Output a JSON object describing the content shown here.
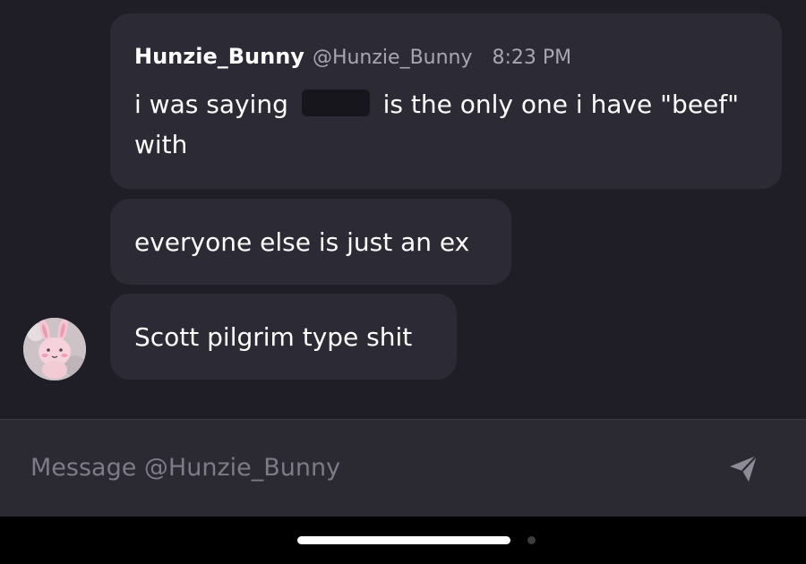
{
  "message_group": {
    "author": "Hunzie_Bunny",
    "handle": "@Hunzie_Bunny",
    "time": "8:23 PM",
    "avatar_icon": "pink-bunny-avatar",
    "messages": [
      {
        "text_before_redaction": "i was saying ",
        "text_after_redaction": " is the only one i have \"beef\" with"
      },
      {
        "text": "everyone else is just an ex"
      },
      {
        "text": "Scott pilgrim type shit"
      }
    ]
  },
  "composer": {
    "placeholder": "Message @Hunzie_Bunny",
    "send_icon": "send-paper-plane-icon"
  },
  "colors": {
    "background": "#1f1d26",
    "bubble": "#2c2a35",
    "composer": "#2b2932",
    "muted_text": "#a9a6b3",
    "placeholder": "#7e7b88"
  }
}
